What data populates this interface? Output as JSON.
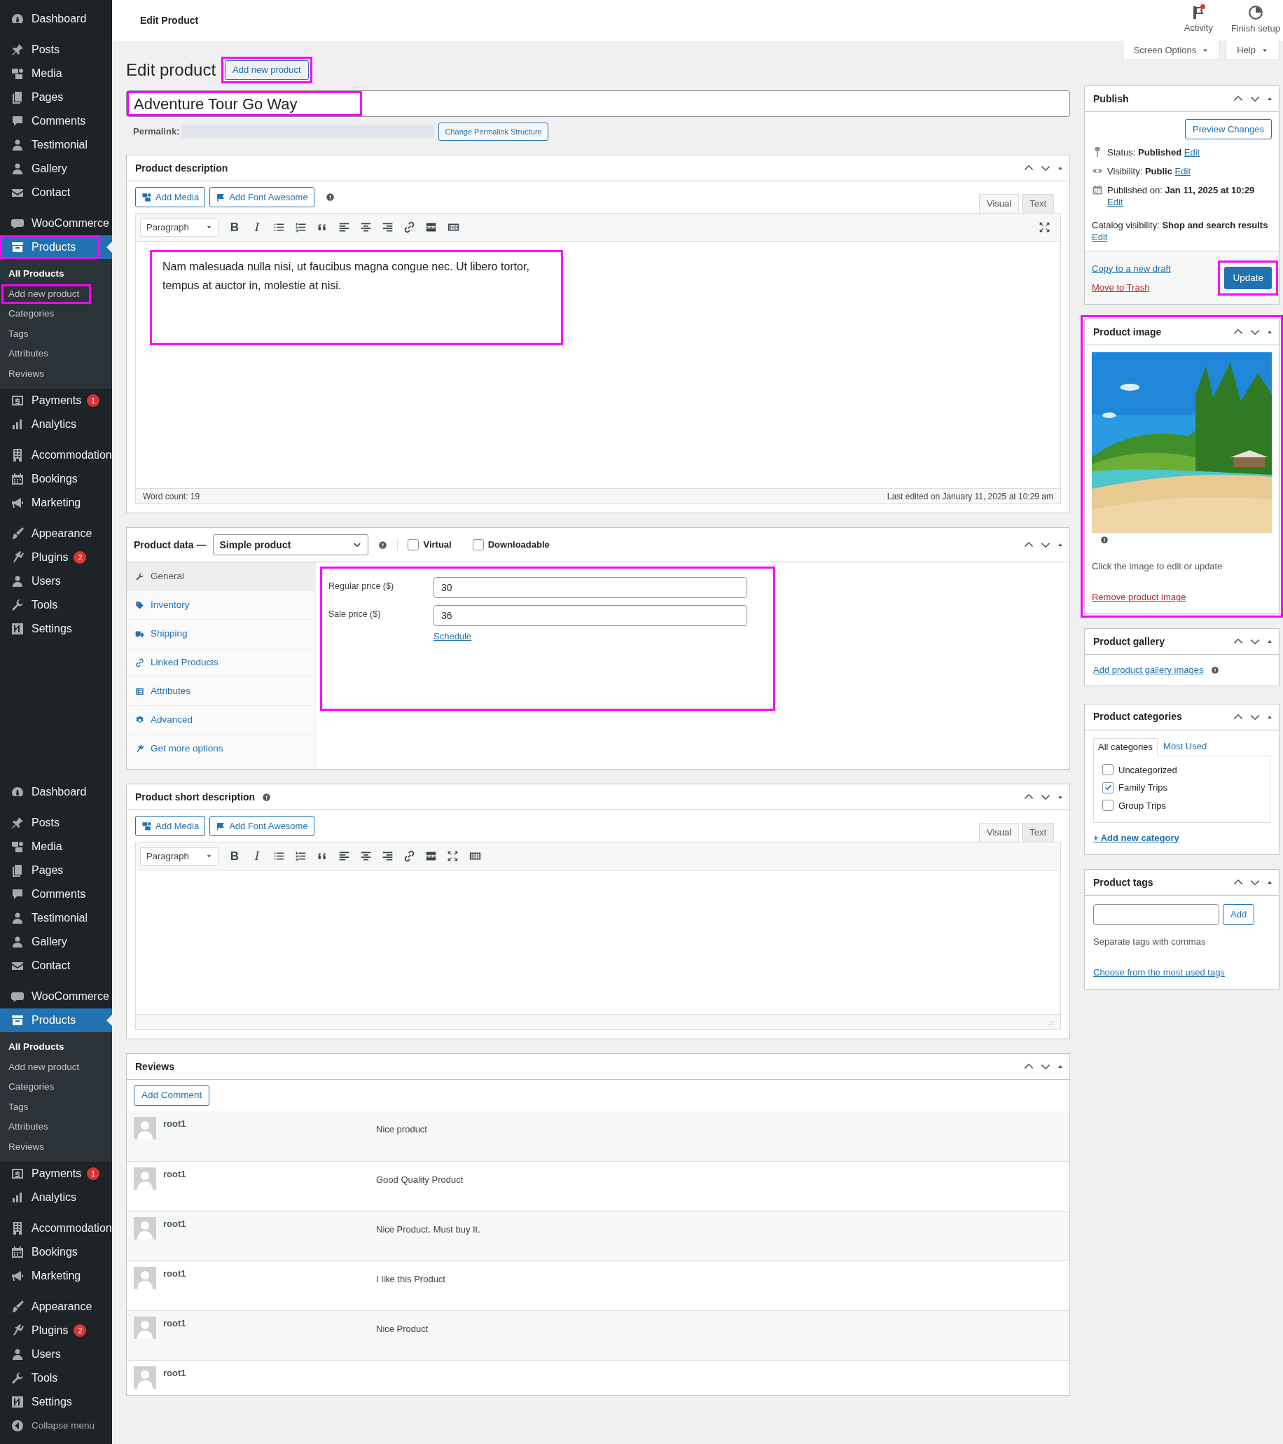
{
  "header": {
    "title": "Edit Product",
    "actions": [
      {
        "label": "Activity",
        "notification": true
      },
      {
        "label": "Finish setup",
        "notification": false
      }
    ]
  },
  "screen_options": "Screen Options",
  "help": "Help",
  "sidebars": [
    {
      "items": [
        {
          "label": "Dashboard",
          "selected": false
        },
        {
          "label": "Posts",
          "selected": false
        },
        {
          "label": "Media",
          "selected": false
        },
        {
          "label": "Pages",
          "selected": false
        },
        {
          "label": "Comments",
          "selected": false
        },
        {
          "label": "Testimonial",
          "selected": false
        },
        {
          "label": "Gallery",
          "selected": false
        },
        {
          "label": "Contact",
          "selected": false
        },
        {
          "label": "WooCommerce",
          "selected": false
        },
        {
          "label": "Products",
          "selected": true,
          "highlighted": true,
          "submenu": [
            {
              "label": "All Products",
              "selected": true,
              "highlighted": false
            },
            {
              "label": "Add new product",
              "selected": false,
              "highlighted": true
            },
            {
              "label": "Categories",
              "selected": false,
              "highlighted": false
            },
            {
              "label": "Tags",
              "selected": false,
              "highlighted": false
            },
            {
              "label": "Attributes",
              "selected": false,
              "highlighted": false
            },
            {
              "label": "Reviews",
              "selected": false,
              "highlighted": false
            }
          ]
        },
        {
          "label": "Payments",
          "selected": false,
          "badge": "1"
        },
        {
          "label": "Analytics",
          "selected": false
        },
        {
          "label": "Accommodation",
          "selected": false
        },
        {
          "label": "Bookings",
          "selected": false
        },
        {
          "label": "Marketing",
          "selected": false
        },
        {
          "label": "Appearance",
          "selected": false
        },
        {
          "label": "Plugins",
          "selected": false,
          "badge": "2"
        },
        {
          "label": "Users",
          "selected": false
        },
        {
          "label": "Tools",
          "selected": false
        },
        {
          "label": "Settings",
          "selected": false
        }
      ]
    },
    {
      "items": [
        {
          "label": "Dashboard",
          "selected": false
        },
        {
          "label": "Posts",
          "selected": false
        },
        {
          "label": "Media",
          "selected": false
        },
        {
          "label": "Pages",
          "selected": false
        },
        {
          "label": "Comments",
          "selected": false
        },
        {
          "label": "Testimonial",
          "selected": false
        },
        {
          "label": "Gallery",
          "selected": false
        },
        {
          "label": "Contact",
          "selected": false
        },
        {
          "label": "WooCommerce",
          "selected": false
        },
        {
          "label": "Products",
          "selected": true,
          "highlighted": false,
          "submenu": [
            {
              "label": "All Products",
              "selected": true,
              "highlighted": false
            },
            {
              "label": "Add new product",
              "selected": false,
              "highlighted": false
            },
            {
              "label": "Categories",
              "selected": false,
              "highlighted": false
            },
            {
              "label": "Tags",
              "selected": false,
              "highlighted": false
            },
            {
              "label": "Attributes",
              "selected": false,
              "highlighted": false
            },
            {
              "label": "Reviews",
              "selected": false,
              "highlighted": false
            }
          ]
        },
        {
          "label": "Payments",
          "selected": false,
          "badge": "1"
        },
        {
          "label": "Analytics",
          "selected": false
        },
        {
          "label": "Accommodation",
          "selected": false
        },
        {
          "label": "Bookings",
          "selected": false
        },
        {
          "label": "Marketing",
          "selected": false
        },
        {
          "label": "Appearance",
          "selected": false
        },
        {
          "label": "Plugins",
          "selected": false,
          "badge": "2"
        },
        {
          "label": "Users",
          "selected": false
        },
        {
          "label": "Tools",
          "selected": false
        },
        {
          "label": "Settings",
          "selected": false
        }
      ],
      "collapse": "Collapse menu"
    }
  ],
  "page_heading": "Edit product",
  "add_new": {
    "label": "Add new product",
    "highlighted": true
  },
  "title_field": {
    "value": "Adventure Tour Go Way",
    "highlighted": true
  },
  "permalink": {
    "label": "Permalink:",
    "button": "Change Permalink Structure"
  },
  "description": {
    "title": "Product description",
    "media_buttons": [
      "Add Media",
      "Add Font Awesome"
    ],
    "tabs": [
      {
        "label": "Visual",
        "selected": true
      },
      {
        "label": "Text",
        "selected": false
      }
    ],
    "format": "Paragraph",
    "format_buttons": [
      "B",
      "I"
    ],
    "content": "Nam malesuada nulla nisi, ut faucibus magna congue nec. Ut libero tortor, tempus at auctor in, molestie at nisi.",
    "content_highlighted": true,
    "word_count": "Word count: 19",
    "last_edited": "Last edited on January 11, 2025 at 10:29 am"
  },
  "product_data": {
    "title": "Product data —",
    "type": "Simple product",
    "options": [
      {
        "label": "Virtual",
        "checked": false
      },
      {
        "label": "Downloadable",
        "checked": false
      }
    ],
    "tabs": [
      {
        "label": "General",
        "selected": true
      },
      {
        "label": "Inventory",
        "selected": false
      },
      {
        "label": "Shipping",
        "selected": false
      },
      {
        "label": "Linked Products",
        "selected": false
      },
      {
        "label": "Attributes",
        "selected": false
      },
      {
        "label": "Advanced",
        "selected": false
      },
      {
        "label": "Get more options",
        "selected": false
      }
    ],
    "fields": [
      {
        "label": "Regular price ($)",
        "value": "30"
      },
      {
        "label": "Sale price ($)",
        "value": "36"
      }
    ],
    "schedule": "Schedule",
    "fields_highlighted": true
  },
  "short_description": {
    "title": "Product short description",
    "media_buttons": [
      "Add Media",
      "Add Font Awesome"
    ],
    "tabs": [
      {
        "label": "Visual",
        "selected": true
      },
      {
        "label": "Text",
        "selected": false
      }
    ],
    "format": "Paragraph",
    "format_buttons": [
      "B",
      "I"
    ]
  },
  "reviews": {
    "title": "Reviews",
    "add_button": "Add Comment",
    "rows": [
      {
        "author": "root1",
        "text": "Nice product"
      },
      {
        "author": "root1",
        "text": "Good Quality Product"
      },
      {
        "author": "root1",
        "text": "Nice Product. Must buy It."
      },
      {
        "author": "root1",
        "text": "I like this Product"
      },
      {
        "author": "root1",
        "text": "Nice Product"
      },
      {
        "author": "root1"
      }
    ]
  },
  "publish": {
    "title": "Publish",
    "preview": "Preview Changes",
    "lines": [
      {
        "label": "Status:",
        "value": "Published",
        "link": "Edit"
      },
      {
        "label": "Visibility:",
        "value": "Public",
        "link": "Edit"
      },
      {
        "label": "Published on:",
        "value": "Jan 11, 2025 at 10:29",
        "link": "Edit"
      },
      {
        "label": "Catalog visibility:",
        "value": "Shop and search results",
        "link": "Edit"
      }
    ],
    "copy": "Copy to a new draft",
    "trash": "Move to Trash",
    "update": {
      "label": "Update",
      "highlighted": true
    }
  },
  "product_image": {
    "title": "Product image",
    "hint": "Click the image to edit or update",
    "remove": "Remove product image",
    "highlighted": true
  },
  "gallery": {
    "title": "Product gallery",
    "link": "Add product gallery images"
  },
  "categories": {
    "title": "Product categories",
    "tabs": [
      {
        "label": "All categories",
        "selected": true
      },
      {
        "label": "Most Used",
        "selected": false
      }
    ],
    "items": [
      {
        "label": "Uncategorized",
        "checked": false
      },
      {
        "label": "Family Trips",
        "checked": true
      },
      {
        "label": "Group Trips",
        "checked": false
      }
    ],
    "add": "+ Add new category"
  },
  "tags": {
    "title": "Product tags",
    "add": "Add",
    "hint": "Separate tags with commas",
    "link": "Choose from the most used tags"
  }
}
